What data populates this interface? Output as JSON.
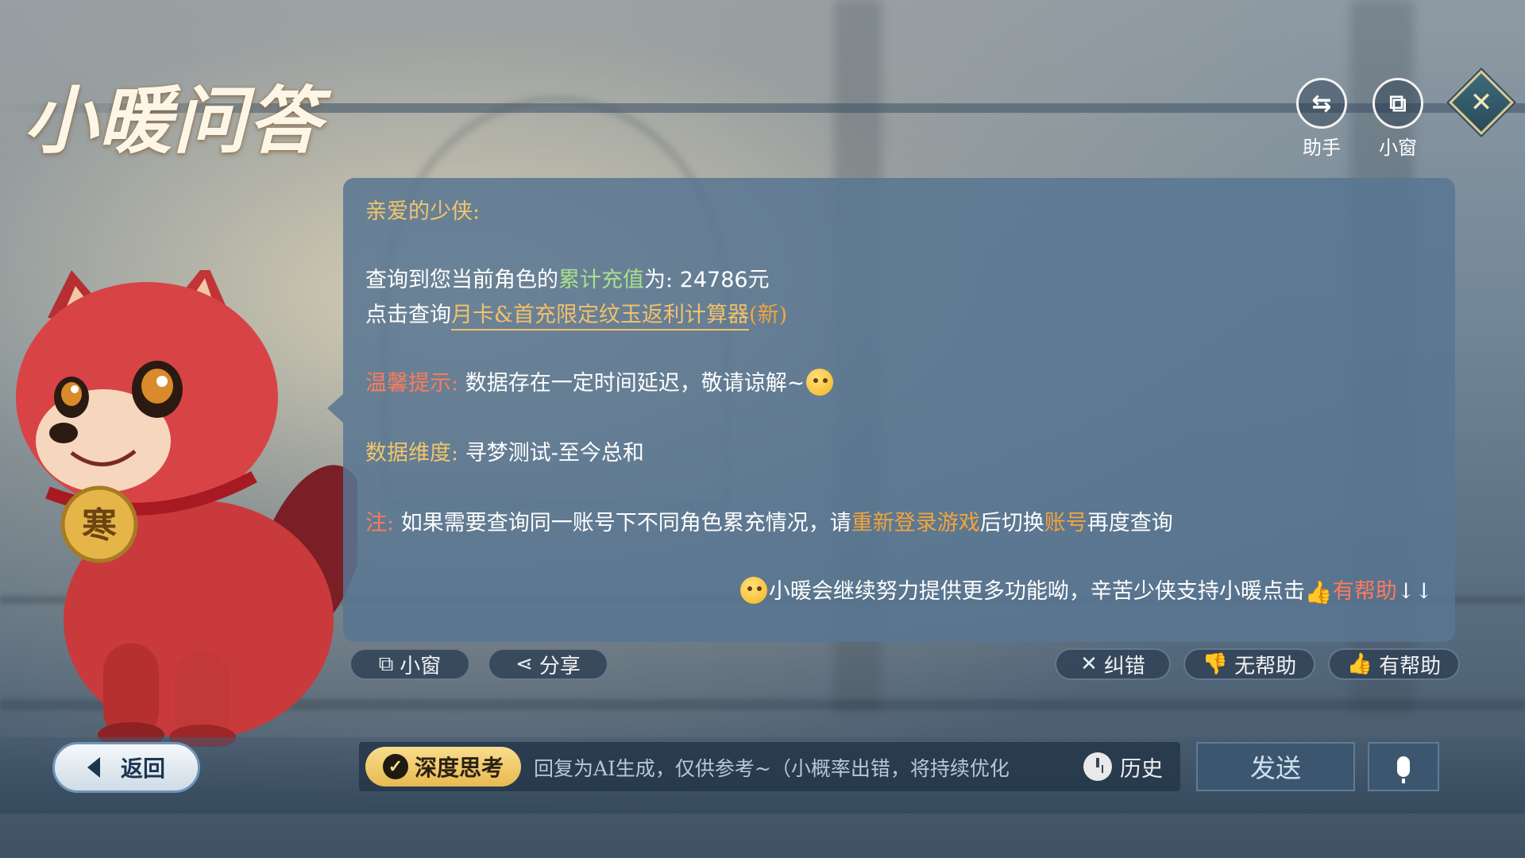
{
  "app": {
    "title": "小暖问答"
  },
  "top_buttons": [
    {
      "label": "助手",
      "icon": "swap-icon"
    },
    {
      "label": "小窗",
      "icon": "mini-window-icon"
    }
  ],
  "message": {
    "greeting": "亲爱的少侠:",
    "recharge": {
      "prefix": "查询到您当前角色的",
      "highlight": "累计充值",
      "middle": "为:",
      "amount": "24786元"
    },
    "calculator": {
      "prefix": "点击查询",
      "link": "月卡&首充限定纹玉返利计算器",
      "suffix": "(新)"
    },
    "tip": {
      "label": "温馨提示:",
      "text": "数据存在一定时间延迟，敬请谅解~"
    },
    "dimension": {
      "label": "数据维度:",
      "text": "寻梦测试-至今总和"
    },
    "note": {
      "label": "注:",
      "part1": "如果需要查询同一账号下不同角色累充情况，请",
      "relogin": "重新登录游戏",
      "part2": "后切换",
      "account": "账号",
      "part3": "再度查询"
    },
    "footer": {
      "text": "小暖会继续努力提供更多功能呦，辛苦少侠支持小暖点击",
      "helpful": "有帮助",
      "arrows": "↓↓"
    }
  },
  "actions": {
    "mini_window": "小窗",
    "share": "分享",
    "correct": "纠错",
    "not_helpful": "无帮助",
    "helpful": "有帮助"
  },
  "bottom": {
    "back": "返回",
    "deep_think": "深度思考",
    "placeholder": "回复为AI生成，仅供参考~（小概率出错，将持续优化",
    "history": "历史",
    "send": "发送"
  },
  "mascot": {
    "medal_text": "寒"
  },
  "colors": {
    "bubble": "#58769 2",
    "gold": "#f2c56b",
    "green": "#a8e08a",
    "red": "#ff7a5c"
  }
}
